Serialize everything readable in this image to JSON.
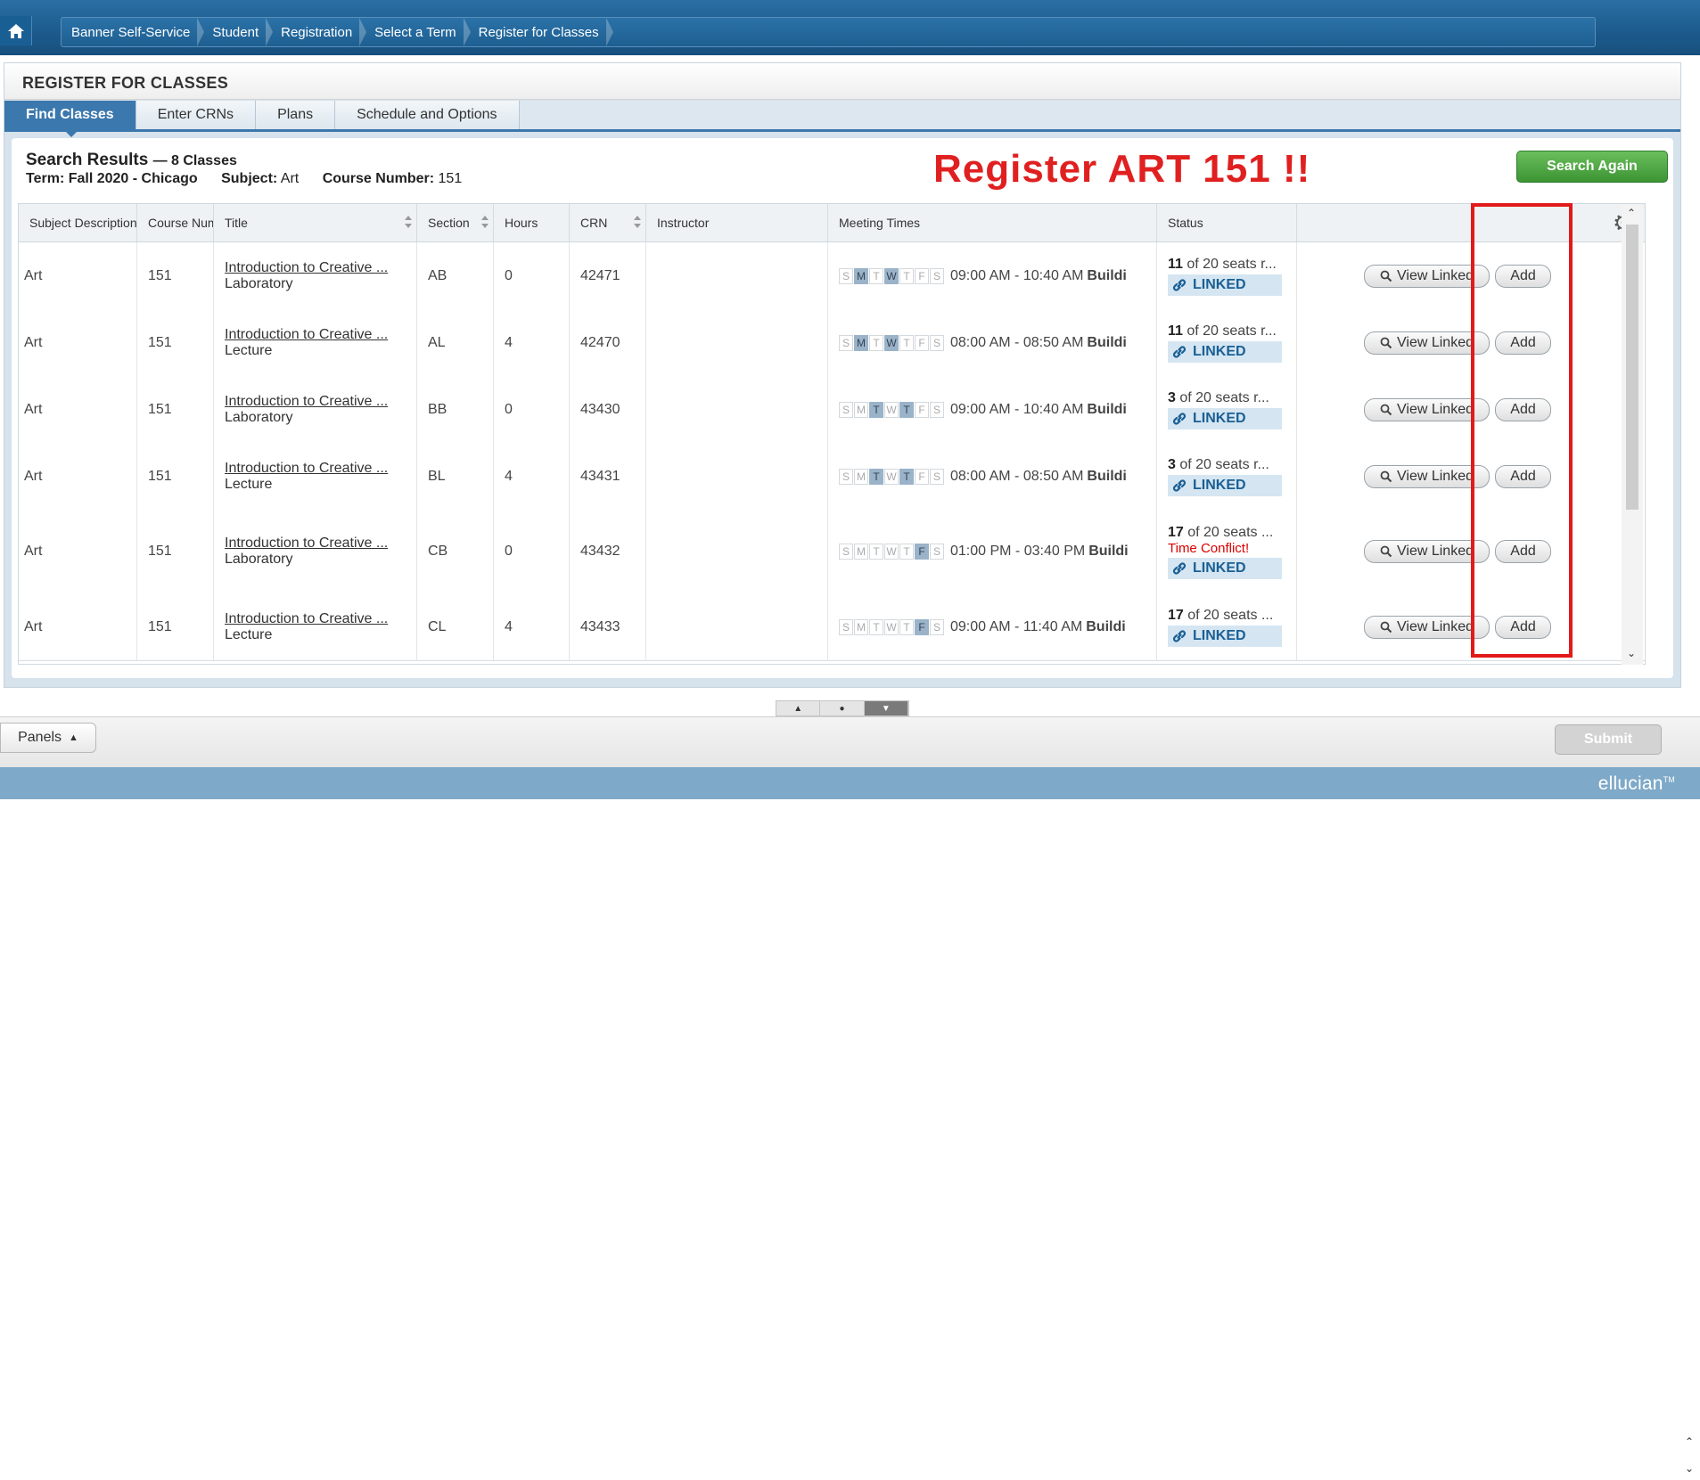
{
  "breadcrumb": [
    "Banner Self-Service",
    "Student",
    "Registration",
    "Select a Term",
    "Register for Classes"
  ],
  "page_title": "REGISTER FOR CLASSES",
  "tabs": [
    "Find Classes",
    "Enter CRNs",
    "Plans",
    "Schedule and Options"
  ],
  "active_tab": "Find Classes",
  "results": {
    "title": "Search Results",
    "count": "— 8 Classes",
    "term_label": "Term: Fall 2020 - Chicago",
    "subject_label": "Subject:",
    "subject": "Art",
    "course_label": "Course Number:",
    "course": "151"
  },
  "annotation": "Register ART 151 !!",
  "search_again_label": "Search Again",
  "columns": [
    "Subject Description",
    "Course Number",
    "Title",
    "Section",
    "Hours",
    "CRN",
    "Instructor",
    "Meeting Times",
    "Status"
  ],
  "day_letters": [
    "S",
    "M",
    "T",
    "W",
    "T",
    "F",
    "S"
  ],
  "linked_label": "LINKED",
  "view_linked_label": "View Linked",
  "add_label": "Add",
  "rows": [
    {
      "subject": "Art",
      "course": "151",
      "title": "Introduction to Creative ...",
      "schedule": "Laboratory",
      "section": "AB",
      "hours": "0",
      "crn": "42471",
      "days": [
        1,
        3
      ],
      "time": "09:00 AM - 10:40 AM",
      "building": "Buildi",
      "seats_num": "11",
      "seats_text": " of 20 seats r...",
      "conflict": ""
    },
    {
      "subject": "Art",
      "course": "151",
      "title": "Introduction to Creative ...",
      "schedule": "Lecture",
      "section": "AL",
      "hours": "4",
      "crn": "42470",
      "days": [
        1,
        3
      ],
      "time": "08:00 AM - 08:50 AM",
      "building": "Buildi",
      "seats_num": "11",
      "seats_text": " of 20 seats r...",
      "conflict": ""
    },
    {
      "subject": "Art",
      "course": "151",
      "title": "Introduction to Creative ...",
      "schedule": "Laboratory",
      "section": "BB",
      "hours": "0",
      "crn": "43430",
      "days": [
        2,
        4
      ],
      "time": "09:00 AM - 10:40 AM",
      "building": "Buildi",
      "seats_num": "3",
      "seats_text": " of 20 seats r...",
      "conflict": ""
    },
    {
      "subject": "Art",
      "course": "151",
      "title": "Introduction to Creative ...",
      "schedule": "Lecture",
      "section": "BL",
      "hours": "4",
      "crn": "43431",
      "days": [
        2,
        4
      ],
      "time": "08:00 AM - 08:50 AM",
      "building": "Buildi",
      "seats_num": "3",
      "seats_text": " of 20 seats r...",
      "conflict": ""
    },
    {
      "subject": "Art",
      "course": "151",
      "title": "Introduction to Creative ...",
      "schedule": "Laboratory",
      "section": "CB",
      "hours": "0",
      "crn": "43432",
      "days": [
        5
      ],
      "time": "01:00 PM - 03:40 PM",
      "building": "Buildi",
      "seats_num": "17",
      "seats_text": " of 20 seats ...",
      "conflict": "Time Conflict!"
    },
    {
      "subject": "Art",
      "course": "151",
      "title": "Introduction to Creative ...",
      "schedule": "Lecture",
      "section": "CL",
      "hours": "4",
      "crn": "43433",
      "days": [
        5
      ],
      "time": "09:00 AM - 11:40 AM",
      "building": "Buildi",
      "seats_num": "17",
      "seats_text": " of 20 seats ...",
      "conflict": ""
    }
  ],
  "panels_label": "Panels",
  "submit_label": "Submit",
  "logo": "ellucian",
  "logo_mark": "TM",
  "colors": {
    "accent": "#3b78ad",
    "annotation_red": "#e02020",
    "green": "#3c9433"
  }
}
